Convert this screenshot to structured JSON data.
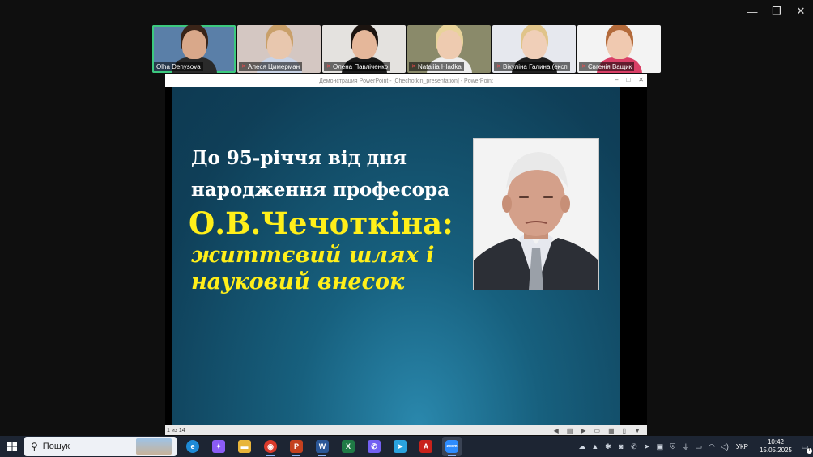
{
  "participants": [
    {
      "name": "Olha Denysova",
      "muted": false,
      "active": true,
      "bg": "#5a7fa8",
      "skin": "#d9a88a",
      "shirt": "#2a2a2a",
      "hair": "#3a2418"
    },
    {
      "name": "Алеся Цимерман",
      "muted": true,
      "active": false,
      "bg": "#d4c7c2",
      "skin": "#e8c7ae",
      "shirt": "#c9d3e6",
      "hair": "#c9a06a"
    },
    {
      "name": "Олена Павліченко",
      "muted": true,
      "active": false,
      "bg": "#e4e2df",
      "skin": "#e5b79a",
      "shirt": "#1b1b1b",
      "hair": "#1c1410"
    },
    {
      "name": "Nataliia Hladka",
      "muted": true,
      "active": false,
      "bg": "#8a8a6a",
      "skin": "#eecbb0",
      "shirt": "#eeeeee",
      "hair": "#e8d39a"
    },
    {
      "name": "Вікуліна Галина (експ",
      "muted": true,
      "active": false,
      "bg": "#e6e8ee",
      "skin": "#f0cfb8",
      "shirt": "#202020",
      "hair": "#e0c48a"
    },
    {
      "name": "Євгенія Ващик",
      "muted": true,
      "active": false,
      "bg": "#f3f3f3",
      "skin": "#f0c9b0",
      "shirt": "#d93f66",
      "hair": "#b36a3a"
    }
  ],
  "ppt": {
    "window_title": "Демонстрация PowerPoint - [Chechotkin_presentation] - PowerPoint",
    "slide_counter": "1 из 14"
  },
  "slide": {
    "line1": "До 95-річчя від дня",
    "line2": "народження професора",
    "line3": "О.В.Чечоткіна:",
    "line4": "життєвий шлях і",
    "line5": "науковий внесок"
  },
  "taskbar": {
    "search_label": "Пошук",
    "apps": [
      {
        "name": "edge",
        "letter": "e",
        "color": "#1e8ad6",
        "running": false
      },
      {
        "name": "copilot",
        "letter": "✦",
        "color": "#8b5cf6",
        "running": false
      },
      {
        "name": "explorer",
        "letter": "▬",
        "color": "#e8b53a",
        "running": false
      },
      {
        "name": "chrome",
        "letter": "◉",
        "color": "#d93a2b",
        "running": true
      },
      {
        "name": "powerpoint",
        "letter": "P",
        "color": "#c4411f",
        "running": true
      },
      {
        "name": "word",
        "letter": "W",
        "color": "#2b5797",
        "running": true
      },
      {
        "name": "excel",
        "letter": "X",
        "color": "#1f7a45",
        "running": false
      },
      {
        "name": "viber",
        "letter": "✆",
        "color": "#7360f2",
        "running": false
      },
      {
        "name": "telegram",
        "letter": "➤",
        "color": "#2aa3df",
        "running": false
      },
      {
        "name": "acrobat",
        "letter": "A",
        "color": "#c9221b",
        "running": false
      },
      {
        "name": "zoom",
        "letter": "zoom",
        "color": "#2d8cff",
        "running": true
      }
    ],
    "language": "УКР",
    "time": "10:42",
    "date": "15.05.2025",
    "notification_count": "1"
  }
}
